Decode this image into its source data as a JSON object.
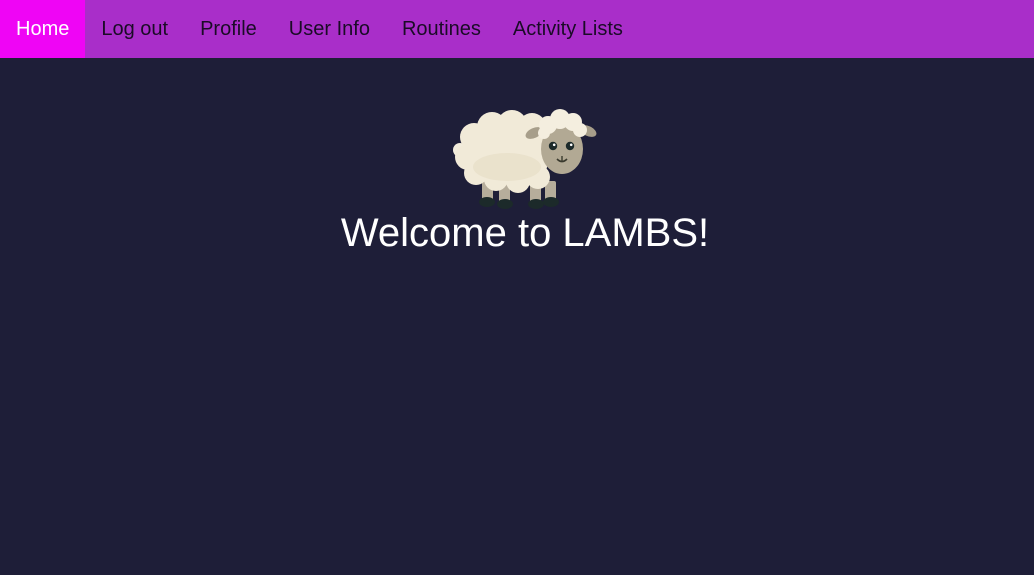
{
  "nav": {
    "items": [
      {
        "label": "Home",
        "active": true
      },
      {
        "label": "Log out",
        "active": false
      },
      {
        "label": "Profile",
        "active": false
      },
      {
        "label": "User Info",
        "active": false
      },
      {
        "label": "Routines",
        "active": false
      },
      {
        "label": "Activity Lists",
        "active": false
      }
    ]
  },
  "hero": {
    "logo_icon": "sheep-icon",
    "title": "Welcome to LAMBS!"
  },
  "colors": {
    "nav_background": "#a92ec9",
    "nav_active": "#ef05f5",
    "page_background": "#1e1e38"
  }
}
